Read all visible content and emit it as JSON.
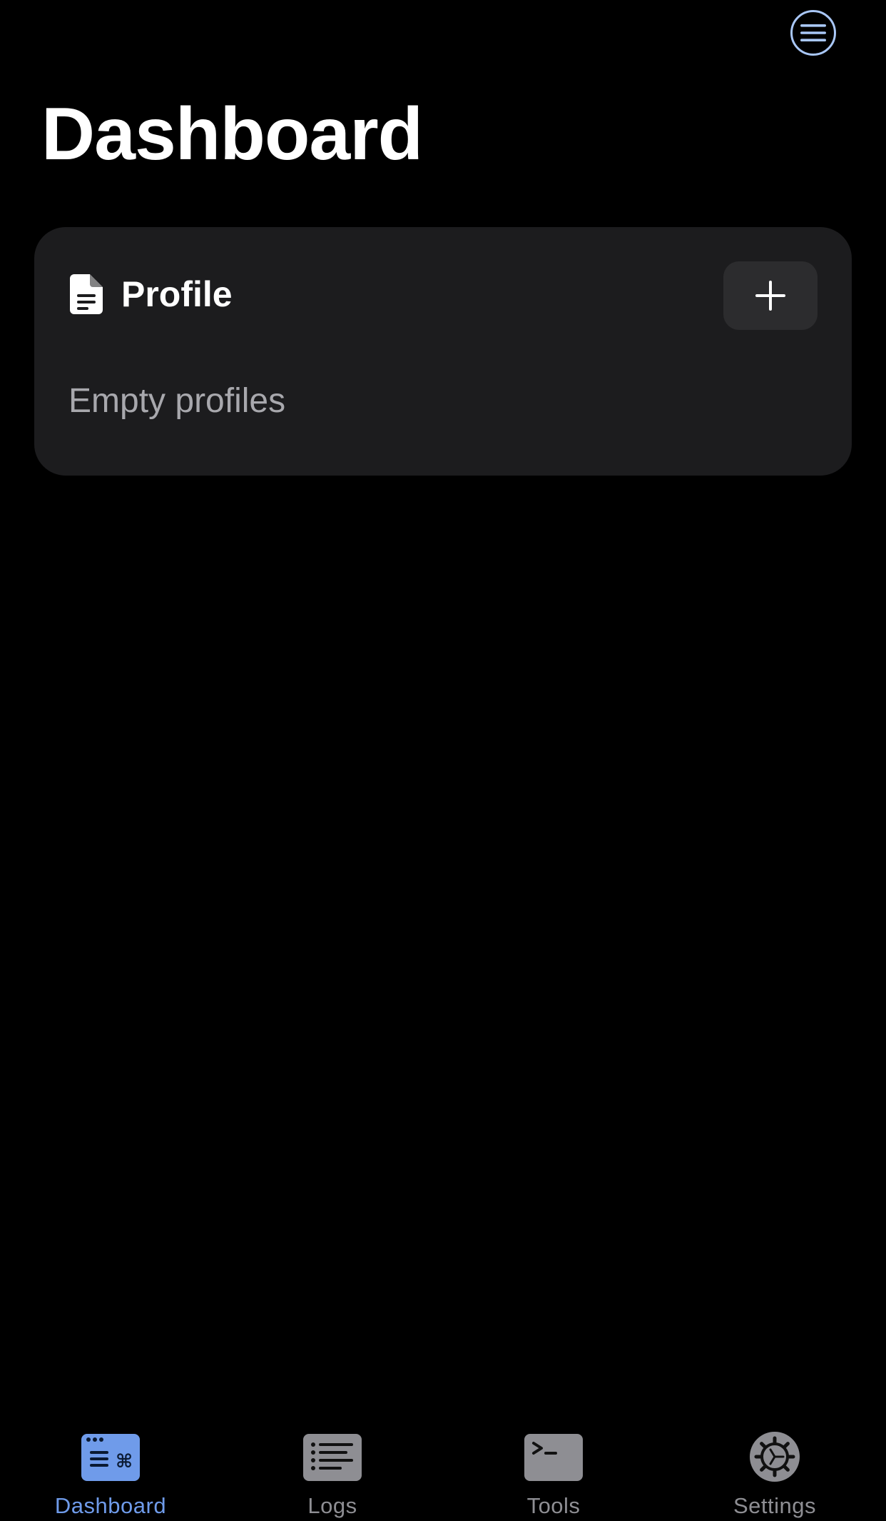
{
  "header": {
    "title": "Dashboard",
    "menu_icon": "hamburger-menu-icon"
  },
  "profile_card": {
    "title": "Profile",
    "icon": "document-icon",
    "add_icon": "plus-icon",
    "empty_text": "Empty profiles"
  },
  "tab_bar": {
    "active_index": 0,
    "items": [
      {
        "label": "Dashboard",
        "icon": "dashboard-icon"
      },
      {
        "label": "Logs",
        "icon": "list-icon"
      },
      {
        "label": "Tools",
        "icon": "terminal-icon"
      },
      {
        "label": "Settings",
        "icon": "gear-icon"
      }
    ]
  },
  "colors": {
    "background": "#000000",
    "card": "#1c1c1e",
    "button": "#2c2c2e",
    "accent": "#6f9bea",
    "inactive": "#8e8e93",
    "secondary_text": "#a8a8ad"
  }
}
